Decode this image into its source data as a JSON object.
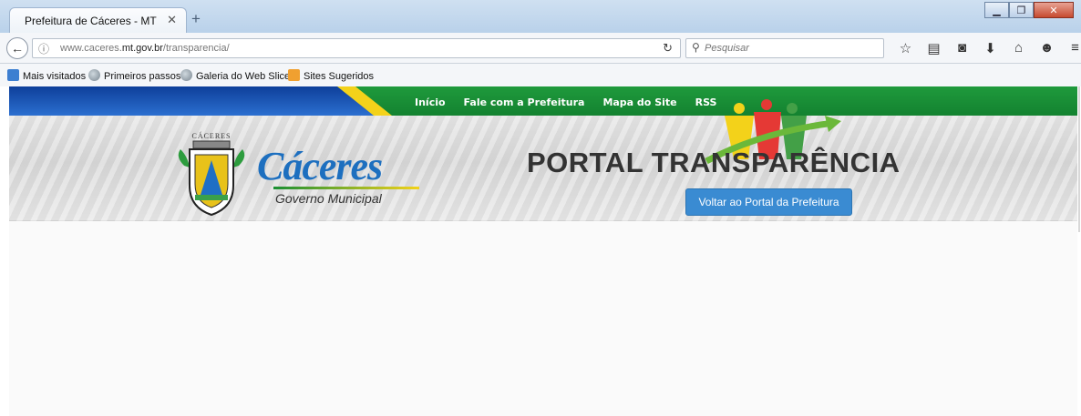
{
  "browser": {
    "tab_title": "Prefeitura de Cáceres - MT",
    "url_prefix": "www.caceres.",
    "url_domain": "mt.gov.br",
    "url_path": "/transparencia/",
    "search_placeholder": "Pesquisar",
    "bookmarks": [
      "Mais visitados",
      "Primeiros passos",
      "Galeria do Web Slice",
      "Sites Sugeridos"
    ]
  },
  "site": {
    "menu": [
      "Início",
      "Fale com a Prefeitura",
      "Mapa do Site",
      "RSS"
    ],
    "logo_name": "Cáceres",
    "logo_subtitle": "Governo Municipal",
    "crest_text": "CÁCERES",
    "portal_title": "PORTAL TRANSPARÊNCIA",
    "back_button": "Voltar ao Portal da Prefeitura"
  },
  "colors": {
    "green_bar": "#138230",
    "blue_wedge": "#0e3f9a",
    "accent_yellow": "#f3d21a",
    "button_blue": "#3a8bd2",
    "logo_blue": "#1d6fbf"
  }
}
